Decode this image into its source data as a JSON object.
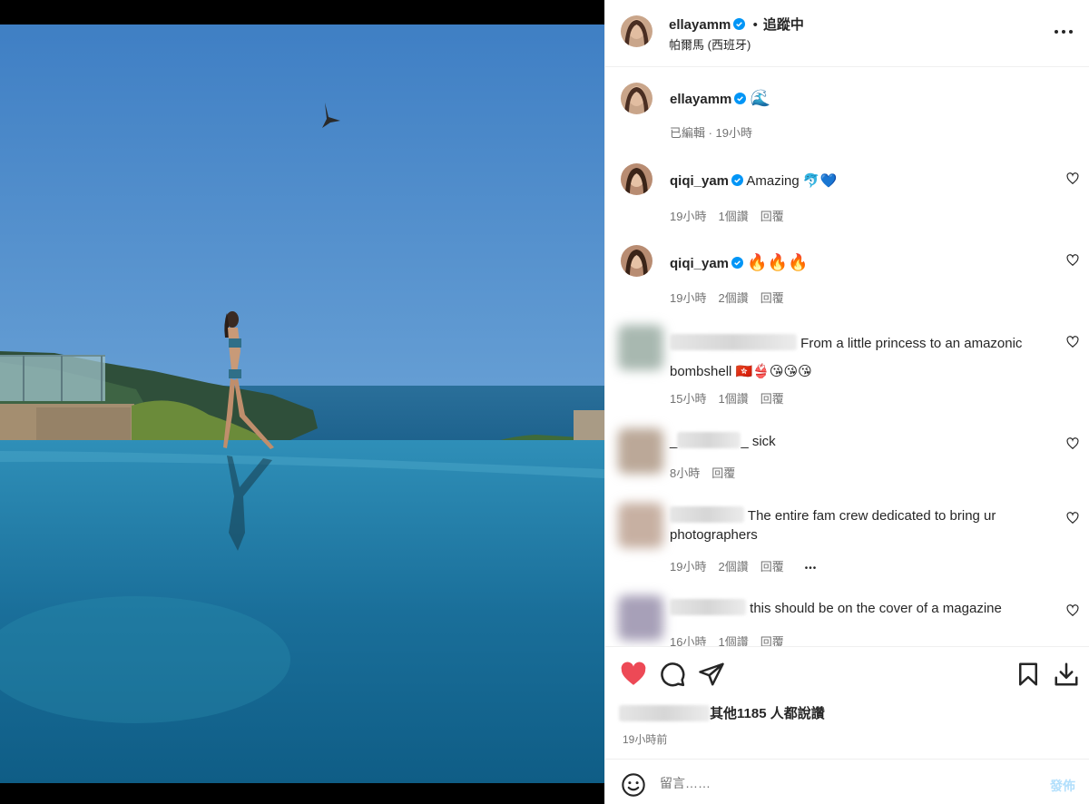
{
  "header": {
    "username": "ellayamm",
    "separator": "•",
    "follow_status": "追蹤中",
    "location": "帕爾馬 (西班牙)"
  },
  "caption": {
    "username": "ellayamm",
    "text": "🌊",
    "meta": "已編輯 · 19小時"
  },
  "comments": [
    {
      "username": "qiqi_yam",
      "text": "Amazing 🐬💙",
      "time": "19小時",
      "likes": "1個讚",
      "reply": "回覆"
    },
    {
      "username": "qiqi_yam",
      "text": "🔥🔥🔥",
      "time": "19小時",
      "likes": "2個讚",
      "reply": "回覆"
    },
    {
      "username": "",
      "text": "From a little princess to an amazonic bombshell 🇭🇰👙😘😘😘",
      "time": "15小時",
      "likes": "1個讚",
      "reply": "回覆"
    },
    {
      "username": "_",
      "text": "_ sick",
      "time": "8小時",
      "likes": "",
      "reply": "回覆"
    },
    {
      "username": "",
      "text": "The entire fam crew dedicated to bring ur photographers",
      "time": "19小時",
      "likes": "2個讚",
      "reply": "回覆",
      "more": "•••"
    },
    {
      "username": "",
      "text": "this should be on the cover of a magazine",
      "time": "16小時",
      "likes": "1個讚",
      "reply": "回覆"
    }
  ],
  "likes": {
    "text": "其他1185 人都說讚"
  },
  "post_time": "19小時前",
  "composer": {
    "placeholder": "留言……",
    "post_label": "發佈"
  },
  "colors": {
    "like_red": "#ed4956",
    "verified_blue": "#0095f6",
    "post_disabled": "#b2dffc"
  }
}
